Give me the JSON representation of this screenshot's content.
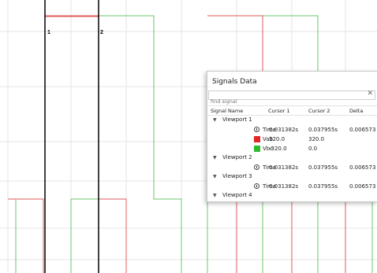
{
  "cursors": {
    "cursor1_label": "1",
    "cursor2_label": "2"
  },
  "panel": {
    "title": "Signals Data",
    "search_placeholder": "find signal",
    "clear_icon": "close-icon",
    "columns": {
      "name": "Signal Name",
      "c1": "Cursor 1",
      "c2": "Cursor 2",
      "delta": "Delta"
    },
    "viewports": [
      {
        "label": "Viewport 1",
        "rows": [
          {
            "name": "Time",
            "icon": "clock-icon",
            "c1": "0.031382s",
            "c2": "0.037955s",
            "delta": "0.006573"
          },
          {
            "name": "Vab",
            "color": "#e32626",
            "c1": "320.0",
            "c2": "320.0",
            "delta": ""
          },
          {
            "name": "Vbc",
            "color": "#2dbb2d",
            "c1": "-320.0",
            "c2": "0.0",
            "delta": ""
          }
        ]
      },
      {
        "label": "Viewport 2",
        "rows": [
          {
            "name": "Time",
            "icon": "clock-icon",
            "c1": "0.031382s",
            "c2": "0.037955s",
            "delta": "0.006573"
          }
        ]
      },
      {
        "label": "Viewport 3",
        "rows": [
          {
            "name": "Time",
            "icon": "clock-icon",
            "c1": "0.031382s",
            "c2": "0.037955s",
            "delta": "0.006573"
          }
        ]
      },
      {
        "label": "Viewport 4",
        "rows": []
      }
    ]
  },
  "colors": {
    "red_signal": "#e05a5a",
    "green_signal": "#6cc46c",
    "grid": "#e6e6e6",
    "cursor": "#000000"
  }
}
